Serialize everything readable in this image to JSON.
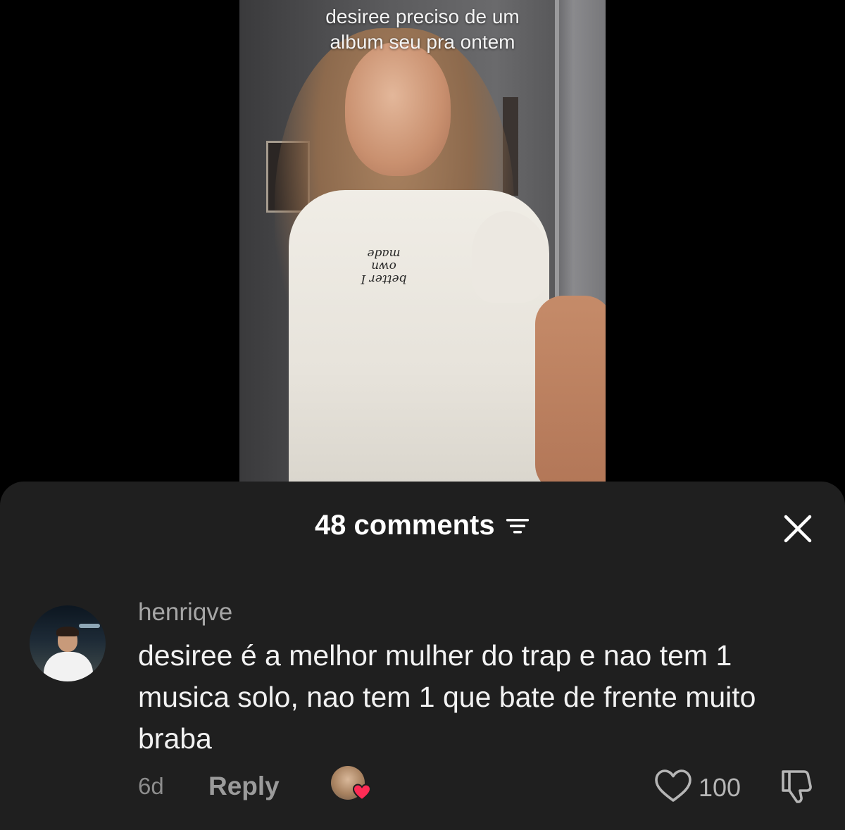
{
  "video": {
    "caption_line1": "desiree preciso de um",
    "caption_line2": "album seu pra ontem",
    "shirt_print": "better I own made"
  },
  "comments_sheet": {
    "title": "48 comments",
    "sort_icon": "sort-filter-icon",
    "close_icon": "close-icon"
  },
  "comment": {
    "username": "henriqve",
    "text": "desiree é a melhor mulher do trap e nao tem 1 musica solo, nao tem 1 que bate de frente muito braba",
    "age": "6d",
    "reply_label": "Reply",
    "likes": "100",
    "liked_by_creator": true
  },
  "colors": {
    "sheet_background": "#1f1f1f",
    "heart_accent": "#fe2c55",
    "muted_text": "#a6a6a6"
  }
}
